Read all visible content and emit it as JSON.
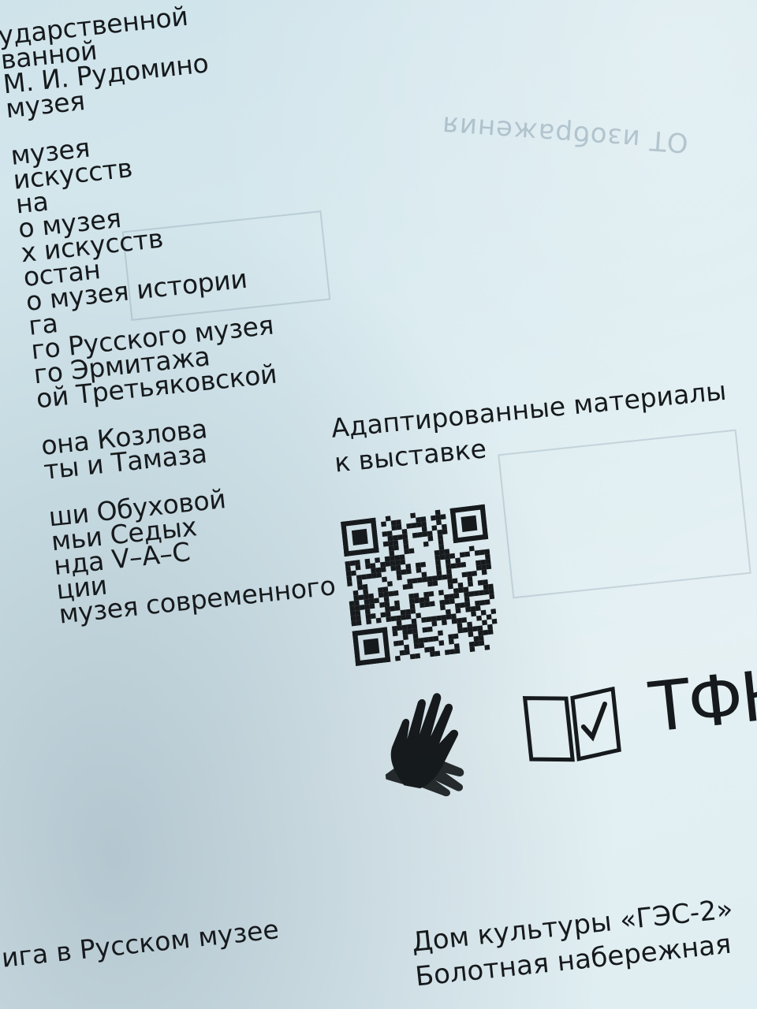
{
  "left_column": {
    "lines": [
      "ударственной",
      "ванной",
      "М. И. Рудомино",
      "музея",
      "",
      "музея",
      "искусств",
      "на",
      "о музея",
      "х искусств",
      "остан",
      "о музея истории",
      "га",
      "го Русского музея",
      "го Эрмитажа",
      "ой Третьяковской",
      "",
      "она Козлова",
      "ты и Тамаза",
      "",
      "ши Обуховой",
      "мьи Седых",
      "нда V–A–C",
      "ции",
      "музея современного"
    ]
  },
  "adapted_materials": {
    "line1": "Адаптированные материалы",
    "line2": "к выставке"
  },
  "icons": {
    "sign_language": "sign-language-icon",
    "easy_read": "easy-read-book-icon",
    "brand_text": "ТФК"
  },
  "bottom": {
    "left_text": "ига в Русском музее",
    "venue_line1": "Дом культуры «ГЭС-2»",
    "venue_line2": "Болотная набережная"
  },
  "colors": {
    "paper": "#d8eaef",
    "ink": "#161a1c"
  }
}
